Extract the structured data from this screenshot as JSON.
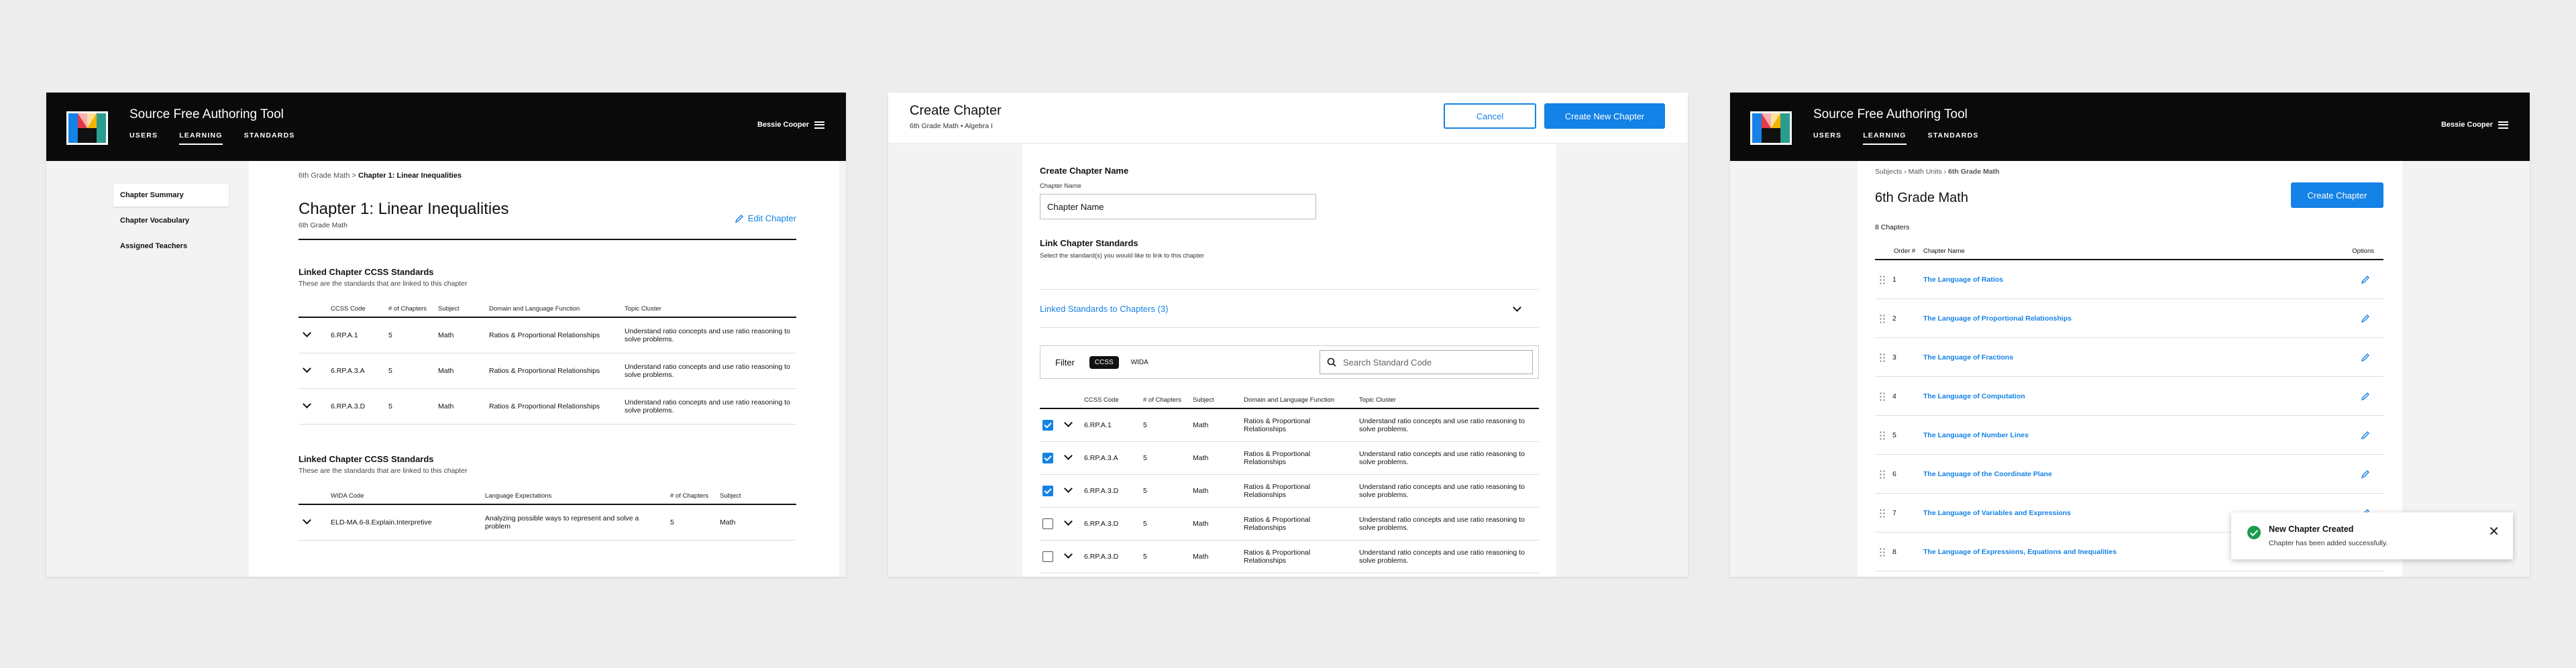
{
  "app": {
    "title": "Source Free Authoring Tool",
    "nav": [
      "USERS",
      "LEARNING",
      "STANDARDS"
    ],
    "active_nav": "LEARNING",
    "user": "Bessie Cooper",
    "accent": "#1482e6"
  },
  "chapter_summary": {
    "side_nav": [
      "Chapter Summary",
      "Chapter Vocabulary",
      "Assigned Teachers"
    ],
    "breadcrumb": {
      "parent": "6th Grade Math",
      "separator": ">",
      "current": "Chapter 1: Linear Inequalities"
    },
    "title": "Chapter 1: Linear Inequalities",
    "subtitle": "6th Grade Math",
    "edit_label": "Edit Chapter",
    "ccss": {
      "title": "Linked Chapter CCSS Standards",
      "desc": "These are the standards that are linked to this chapter",
      "columns": [
        "CCSS Code",
        "# of Chapters",
        "Subject",
        "Domain and Language Function",
        "Topic Cluster"
      ],
      "rows": [
        {
          "code": "6.RP.A.1",
          "chapters": "5",
          "subject": "Math",
          "domain": "Ratios & Proportional Relationships",
          "cluster": "Understand ratio concepts and use ratio reasoning to solve problems."
        },
        {
          "code": "6.RP.A.3.A",
          "chapters": "5",
          "subject": "Math",
          "domain": "Ratios & Proportional Relationships",
          "cluster": "Understand ratio concepts and use ratio reasoning to solve problems."
        },
        {
          "code": "6.RP.A.3.D",
          "chapters": "5",
          "subject": "Math",
          "domain": "Ratios & Proportional Relationships",
          "cluster": "Understand ratio concepts and use ratio reasoning to solve problems."
        }
      ]
    },
    "wida": {
      "title": "Linked Chapter CCSS Standards",
      "desc": "These are the standards that are linked to this chapter",
      "columns": [
        "WIDA Code",
        "Language Expectations",
        "# of Chapters",
        "Subject"
      ],
      "rows": [
        {
          "code": "ELD-MA.6-8.Explain.Interpretive",
          "expectation": "Analyzing possible ways to represent and solve a problem",
          "chapters": "5",
          "subject": "Math"
        }
      ]
    }
  },
  "create_chapter": {
    "title": "Create Chapter",
    "subtitle": "6th Grade Math  •  Algebra I",
    "cancel_label": "Cancel",
    "create_label": "Create New Chapter",
    "name_section": "Create Chapter Name",
    "name_label": "Chapter Name",
    "name_placeholder": "Chapter Name",
    "link_section": "Link Chapter Standards",
    "link_desc": "Select the standard(s) you would like to link to this chapter",
    "linked_accordion": "Linked Standards to Chapters (3)",
    "filter_label": "Filter",
    "filter_pills": [
      "CCSS",
      "WIDA"
    ],
    "search_placeholder": "Search Standard Code",
    "columns": [
      "CCSS Code",
      "# of Chapters",
      "Subject",
      "Domain and Language Function",
      "Topic Cluster"
    ],
    "rows": [
      {
        "checked": true,
        "code": "6.RP.A.1",
        "chapters": "5",
        "subject": "Math",
        "domain": "Ratios & Proportional Relationships",
        "cluster": "Understand ratio concepts and use ratio reasoning to solve problems."
      },
      {
        "checked": true,
        "code": "6.RP.A.3.A",
        "chapters": "5",
        "subject": "Math",
        "domain": "Ratios & Proportional Relationships",
        "cluster": "Understand ratio concepts and use ratio reasoning to solve problems."
      },
      {
        "checked": true,
        "code": "6.RP.A.3.D",
        "chapters": "5",
        "subject": "Math",
        "domain": "Ratios & Proportional Relationships",
        "cluster": "Understand ratio concepts and use ratio reasoning to solve problems."
      },
      {
        "checked": false,
        "code": "6.RP.A.3.D",
        "chapters": "5",
        "subject": "Math",
        "domain": "Ratios & Proportional Relationships",
        "cluster": "Understand ratio concepts and use ratio reasoning to solve problems."
      },
      {
        "checked": false,
        "code": "6.RP.A.3.D",
        "chapters": "5",
        "subject": "Math",
        "domain": "Ratios & Proportional Relationships",
        "cluster": "Understand ratio concepts and use ratio reasoning to solve problems."
      }
    ]
  },
  "grade_view": {
    "breadcrumb": [
      "Subjects",
      "Math Units",
      "6th Grade Math"
    ],
    "title": "6th Grade Math",
    "create_label": "Create Chapter",
    "count": "8 Chapters",
    "columns": [
      "Order #",
      "Chapter Name",
      "Options"
    ],
    "chapters": [
      {
        "order": "1",
        "name": "The Language of Ratios"
      },
      {
        "order": "2",
        "name": "The Language of Proportional Relationships"
      },
      {
        "order": "3",
        "name": "The Language of Fractions"
      },
      {
        "order": "4",
        "name": "The Language of Computation"
      },
      {
        "order": "5",
        "name": "The Language of Number Lines"
      },
      {
        "order": "6",
        "name": "The Language of the Coordinate Plane"
      },
      {
        "order": "7",
        "name": "The Language of Variables and Expressions"
      },
      {
        "order": "8",
        "name": "The Language of Expressions, Equations and Inequalities"
      }
    ],
    "toast": {
      "title": "New Chapter Created",
      "message": "Chapter has been added successfully.",
      "color": "#1a9c4c"
    }
  }
}
